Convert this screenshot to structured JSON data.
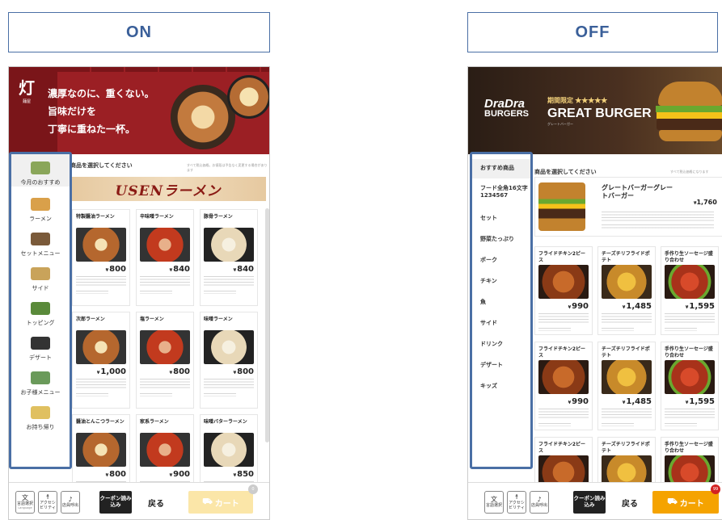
{
  "headers": {
    "on": "ON",
    "off": "OFF"
  },
  "left": {
    "banner_lines": [
      "濃厚なのに、重くない。",
      "旨味だけを",
      "丁寧に重ねた一杯。"
    ],
    "logo_char": "灯",
    "logo_sub": "麺屋",
    "prompt": "商品を選択してください",
    "prompt_note": "すべて税込価格。お値段は予告なく変更する場合があります",
    "feature": "USENラーメン",
    "nav": [
      "今月のおすすめ",
      "ラーメン",
      "セットメニュー",
      "サイド",
      "トッピング",
      "デザート",
      "お子様メニュー",
      "お持ち帰り"
    ],
    "cards": [
      {
        "name": "特製醤油ラーメン",
        "price": "800"
      },
      {
        "name": "辛味噌ラーメン",
        "price": "840"
      },
      {
        "name": "豚骨ラーメン",
        "price": "840"
      },
      {
        "name": "次郎ラーメン",
        "price": "1,000"
      },
      {
        "name": "塩ラーメン",
        "price": "800"
      },
      {
        "name": "味噌ラーメン",
        "price": "800"
      },
      {
        "name": "醤油とんこつラーメン",
        "price": "800"
      },
      {
        "name": "家系ラーメン",
        "price": "900"
      },
      {
        "name": "味噌バターラーメン",
        "price": "850"
      }
    ],
    "bottom": {
      "lang": "言語選択",
      "lang_en": "Language",
      "access": "アクセシビリティ",
      "staff": "店員呼出",
      "coupon": "クーポン読み込み",
      "back": "戻る",
      "cart": "カート",
      "badge": "0"
    }
  },
  "right": {
    "brand_top": "DraDra",
    "brand_bottom": "BURGERS",
    "promo_small": "期間限定 ★★★★★",
    "promo_big": "GREAT BURGER",
    "promo_sub": "グレートバーガー",
    "prompt": "商品を選択してください",
    "prompt_note": "すべて税込価格になります",
    "nav": [
      "おすすめ商品",
      "フード全角16文字1234567",
      "セット",
      "野菜たっぷり",
      "ポーク",
      "チキン",
      "魚",
      "サイド",
      "ドリンク",
      "デザート",
      "キッズ"
    ],
    "featured": {
      "name": "グレートバーガーグレートバーガー",
      "price": "1,760"
    },
    "cards": [
      {
        "name": "フライドチキン2ピース",
        "price": "990"
      },
      {
        "name": "チーズチリフライドポテト",
        "price": "1,485"
      },
      {
        "name": "手作り生ソーセージ盛り合わせ",
        "price": "1,595"
      },
      {
        "name": "フライドチキン2ピース",
        "price": "990"
      },
      {
        "name": "チーズチリフライドポテト",
        "price": "1,485"
      },
      {
        "name": "手作り生ソーセージ盛り合わせ",
        "price": "1,595"
      },
      {
        "name": "フライドチキン2ピース",
        "price": ""
      },
      {
        "name": "チーズチリフライドポテト",
        "price": ""
      },
      {
        "name": "手作り生ソーセージ盛り合わせ",
        "price": ""
      }
    ],
    "bottom": {
      "lang": "言語選択",
      "access": "アクセシビリティ",
      "staff": "店員呼出",
      "coupon": "クーポン読み込み",
      "back": "戻る",
      "cart": "カート",
      "badge": "99"
    }
  },
  "currency": "¥",
  "colors": {
    "frame": "#4a6fa5",
    "ramen_red": "#9b1f24",
    "burger_orange": "#f5a300",
    "cart_disabled": "#fbe6a8"
  }
}
